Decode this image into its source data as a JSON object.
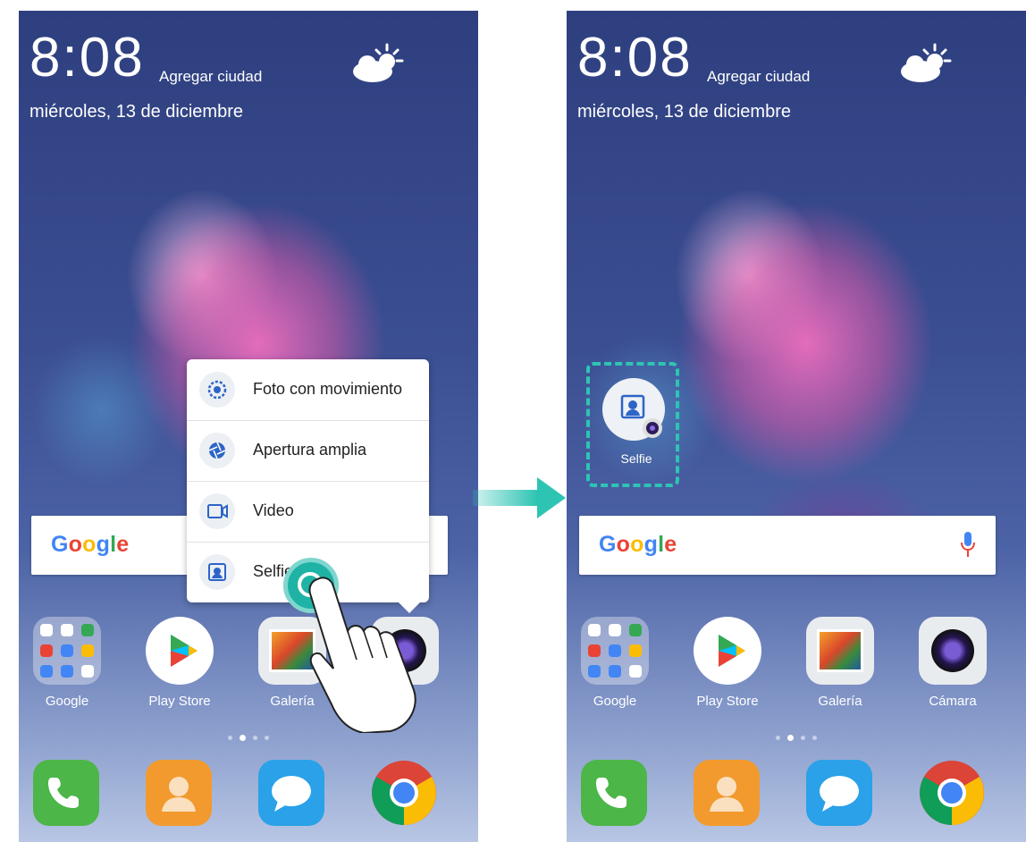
{
  "left_screen": {
    "time": "8:08",
    "city_label": "Agregar ciudad",
    "date": "miércoles, 13 de diciembre",
    "search_logo": "Google",
    "shortcut_menu": {
      "items": [
        {
          "label": "Foto con movimiento",
          "icon": "motion-photo-icon"
        },
        {
          "label": "Apertura amplia",
          "icon": "aperture-icon"
        },
        {
          "label": "Video",
          "icon": "video-camera-icon"
        },
        {
          "label": "Selfie",
          "icon": "selfie-icon"
        }
      ]
    },
    "apps": [
      {
        "label": "Google",
        "icon": "folder-icon"
      },
      {
        "label": "Play Store",
        "icon": "play-store-icon"
      },
      {
        "label": "Galería",
        "icon": "gallery-icon"
      },
      {
        "label": "",
        "icon": "camera-icon"
      }
    ],
    "dock": [
      "phone-icon",
      "contacts-icon",
      "messages-icon",
      "chrome-icon"
    ]
  },
  "right_screen": {
    "time": "8:08",
    "city_label": "Agregar ciudad",
    "date": "miércoles, 13 de diciembre",
    "search_logo": "Google",
    "new_shortcut": {
      "label": "Selfie",
      "icon": "selfie-icon"
    },
    "apps": [
      {
        "label": "Google",
        "icon": "folder-icon"
      },
      {
        "label": "Play Store",
        "icon": "play-store-icon"
      },
      {
        "label": "Galería",
        "icon": "gallery-icon"
      },
      {
        "label": "Cámara",
        "icon": "camera-icon"
      }
    ],
    "dock": [
      "phone-icon",
      "contacts-icon",
      "messages-icon",
      "chrome-icon"
    ]
  },
  "colors": {
    "highlight": "#2ec4b3",
    "google_blue": "#4285f4",
    "google_red": "#ea4335",
    "google_yellow": "#fbbc05",
    "google_green": "#34a853"
  }
}
